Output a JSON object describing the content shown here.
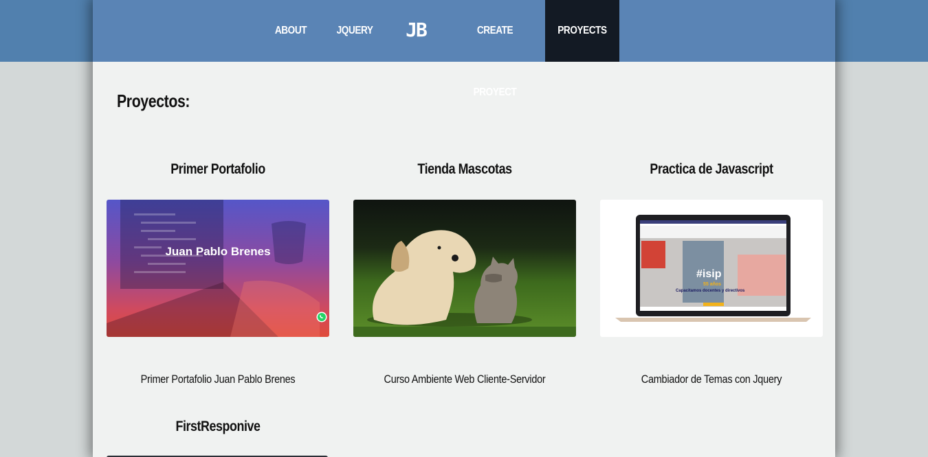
{
  "nav": {
    "about": "ABOUT",
    "jquery": "JQUERY",
    "logo": "JB",
    "create": "CREATE PROYECT",
    "proyects": "PROYECTS"
  },
  "section_title": "Proyectos:",
  "projects": [
    {
      "title": "Primer Portafolio",
      "image_text": "Juan Pablo Brenes",
      "description": "Primer Portafolio Juan Pablo Brenes"
    },
    {
      "title": "Tienda Mascotas",
      "description": "Curso Ambiente Web Cliente-Servidor"
    },
    {
      "title": "Practica de Javascript",
      "image_text": "#isip",
      "image_subtext": "55 años",
      "image_caption": "Capacitamos docentes y directivos",
      "description": "Cambiador de Temas con Jquery"
    },
    {
      "title": "FirstResponive"
    }
  ],
  "colors": {
    "nav_bg": "#5a84b5",
    "nav_active_bg": "#131a24",
    "page_bg": "#f0f2f1",
    "outer_bg": "#d3d8d8"
  }
}
